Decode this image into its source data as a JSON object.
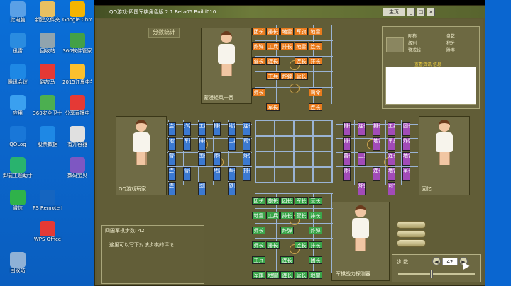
{
  "desktop": {
    "icons": [
      {
        "label": "此电脑",
        "color": "#5aa0e6"
      },
      {
        "label": "迅雷",
        "color": "#2a8ce0"
      },
      {
        "label": "腾讯会议",
        "color": "#1e88e5"
      },
      {
        "label": "应用",
        "color": "#3aa0f0"
      },
      {
        "label": "QQLog",
        "color": "#1977d8"
      },
      {
        "label": "卸载主题助手",
        "color": "#29b36e"
      },
      {
        "label": "微信",
        "color": "#2fb24a"
      },
      {
        "label": "回收站",
        "color": "#8fb1d6"
      },
      {
        "label": "新建文件夹",
        "color": "#e8c061"
      },
      {
        "label": "回收站",
        "color": "#90a4ae"
      },
      {
        "label": "路灰马",
        "color": "#e53935"
      },
      {
        "label": "360安全卫士",
        "color": "#4caf50"
      },
      {
        "label": "股票数据",
        "color": "#1e88e5"
      },
      {
        "label": "PS Remote Play",
        "color": "#1565c0"
      },
      {
        "label": "WPS Office",
        "color": "#e53935"
      },
      {
        "label": "Google Chrome",
        "color": "#f4b400"
      },
      {
        "label": "360软件管家",
        "color": "#43a047"
      },
      {
        "label": "2015江夏中学数据",
        "color": "#fbc02d"
      },
      {
        "label": "分享直播中",
        "color": "#e53935"
      },
      {
        "label": "有升容器",
        "color": "#e0e0e0"
      },
      {
        "label": "数码宝贝",
        "color": "#7e57c2"
      }
    ]
  },
  "window": {
    "title": "QQ游戏-四国军棋角色版 2.1 Beta05 Build010",
    "buttons": [
      "主页",
      "_",
      "□",
      "×"
    ]
  },
  "game": {
    "stats_button": "分数统计",
    "players": {
      "top": "蒙漫轻风十吞",
      "left": "QQ游戏玩家",
      "right": "回忆",
      "bottom": "军棋战力探测器"
    },
    "info": {
      "labels": [
        "昵称",
        "级别",
        "警戒线",
        "盘数",
        "积分",
        "胜率"
      ],
      "link": "查看资讯 信息"
    },
    "chat": {
      "header": "四国军棋步数: 42",
      "body": "这里可以写下对该步棋的评论!"
    },
    "control": {
      "label": "步 数",
      "value": "42",
      "prev": "◀",
      "next": "▶"
    },
    "pieces": {
      "orange": [
        "团长",
        "排长",
        "地雷",
        "军旗",
        "地雷",
        "炸弹",
        "工兵",
        "排长",
        "地雷",
        "连长",
        "营长",
        "连长",
        "连长",
        "排长",
        "工兵",
        "炸弹",
        "营长",
        "师长",
        "司令",
        "军长",
        "连长"
      ],
      "green": [
        "团长",
        "旅长",
        "团长",
        "军长",
        "营长",
        "工兵",
        "排长",
        "营长",
        "师长",
        "炸弹",
        "炸弹",
        "师长",
        "排长",
        "连长",
        "工兵",
        "连长",
        "团长",
        "地雷",
        "连长",
        "营长",
        "地雷",
        "军旗",
        "地雷",
        "排长",
        "排长"
      ],
      "blue": [
        "连长",
        "炸弹",
        "工兵",
        "排长",
        "地雷",
        "连长",
        "地雷",
        "军旗",
        "排长",
        "工兵",
        "司令",
        "营长",
        "团长",
        "师长",
        "炸弹",
        "连长",
        "营长",
        "地雷",
        "军长",
        "排长",
        "连长",
        "团长",
        "旅长"
      ],
      "purple": [
        "排长",
        "连长",
        "排长",
        "工兵",
        "团长",
        "排长",
        "地雷",
        "军旗",
        "炸弹",
        "营长",
        "工兵",
        "连长",
        "地雷",
        "师长",
        "连长",
        "地雷",
        "军长",
        "炸弹",
        "司令"
      ]
    }
  }
}
